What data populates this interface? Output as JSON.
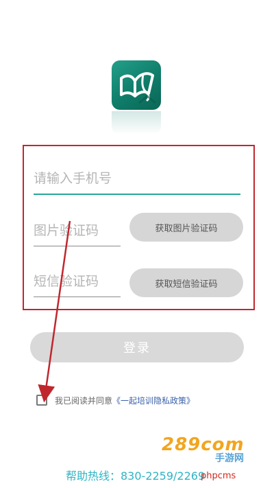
{
  "app": {
    "logo_icon": "book-leaf-icon"
  },
  "form": {
    "phone_placeholder": "请输入手机号",
    "image_code_placeholder": "图片验证码",
    "get_image_code_label": "获取图片验证码",
    "sms_code_placeholder": "短信验证码",
    "get_sms_code_label": "获取短信验证码"
  },
  "login": {
    "label": "登录"
  },
  "agreement": {
    "text": "我已阅读并同意",
    "policy_link": "《一起培训隐私政策》"
  },
  "footer": {
    "hotline": "帮助热线：830-2259/2269"
  },
  "watermark": {
    "logo_text": "289com",
    "logo_sub": "手游网",
    "text": "phpcms"
  },
  "colors": {
    "brand": "#0f7c69",
    "accent": "#26a69a",
    "annotation": "#c0262d",
    "link": "#3a61a8",
    "hotline": "#2fb4c3"
  }
}
